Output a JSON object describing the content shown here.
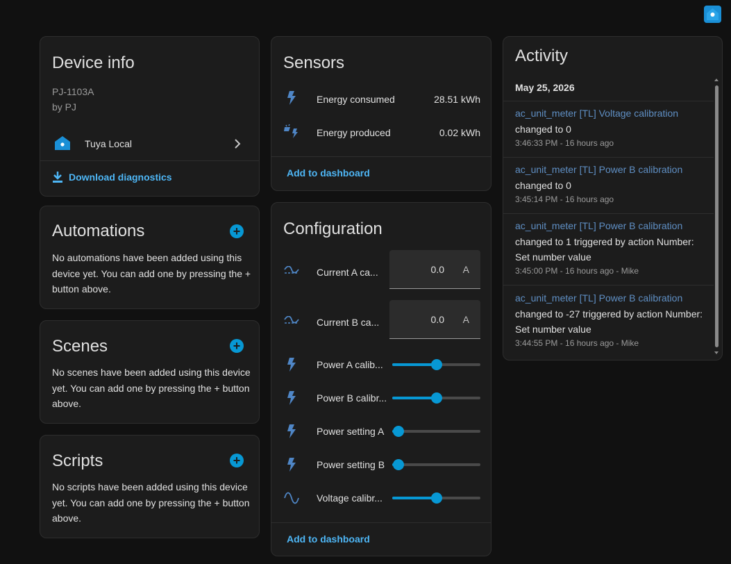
{
  "device_info": {
    "title": "Device info",
    "model": "PJ-1103A",
    "manufacturer": "by PJ",
    "integration": "Tuya Local",
    "download_label": "Download diagnostics"
  },
  "automations": {
    "title": "Automations",
    "description": "No automations have been added using this device yet. You can add one by pressing the + button above."
  },
  "scenes": {
    "title": "Scenes",
    "description": "No scenes have been added using this device yet. You can add one by pressing the + button above."
  },
  "scripts": {
    "title": "Scripts",
    "description": "No scripts have been added using this device yet. You can add one by pressing the + button above."
  },
  "sensors": {
    "title": "Sensors",
    "items": [
      {
        "label": "Energy consumed",
        "value": "28.51 kWh",
        "icon": "lightning-icon"
      },
      {
        "label": "Energy produced",
        "value": "0.02 kWh",
        "icon": "solar-power-icon"
      }
    ],
    "add_label": "Add to dashboard"
  },
  "configuration": {
    "title": "Configuration",
    "number_fields": [
      {
        "label": "Current A ca...",
        "value": "0.0",
        "unit": "A",
        "icon": "current-ac-icon"
      },
      {
        "label": "Current B ca...",
        "value": "0.0",
        "unit": "A",
        "icon": "current-ac-icon"
      }
    ],
    "sliders": [
      {
        "label": "Power A calib...",
        "level": 0.5,
        "icon": "lightning-icon"
      },
      {
        "label": "Power B calibr...",
        "level": 0.5,
        "icon": "lightning-icon"
      },
      {
        "label": "Power setting A",
        "level": 0.07,
        "icon": "lightning-icon"
      },
      {
        "label": "Power setting B",
        "level": 0.07,
        "icon": "lightning-icon"
      },
      {
        "label": "Voltage calibr...",
        "level": 0.5,
        "icon": "sine-wave-icon"
      }
    ],
    "add_label": "Add to dashboard"
  },
  "activity": {
    "title": "Activity",
    "date": "May 25, 2026",
    "entries": [
      {
        "name": "ac_unit_meter [TL] Voltage calibration",
        "message": "changed to 0",
        "time": "3:46:33 PM - 16 hours ago"
      },
      {
        "name": "ac_unit_meter [TL] Power B calibration",
        "message": "changed to 0",
        "time": "3:45:14 PM - 16 hours ago"
      },
      {
        "name": "ac_unit_meter [TL] Power B calibration",
        "message": "changed to 1 triggered by action Number: Set number value",
        "time": "3:45:00 PM - 16 hours ago - Mike"
      },
      {
        "name": "ac_unit_meter [TL] Power B calibration",
        "message": "changed to -27 triggered by action Number: Set number value",
        "time": "3:44:55 PM - 16 hours ago - Mike"
      }
    ]
  },
  "colors": {
    "accent": "#0798d4",
    "link": "#4eb6f5",
    "card_bg": "#1c1c1c",
    "page_bg": "#111111"
  }
}
